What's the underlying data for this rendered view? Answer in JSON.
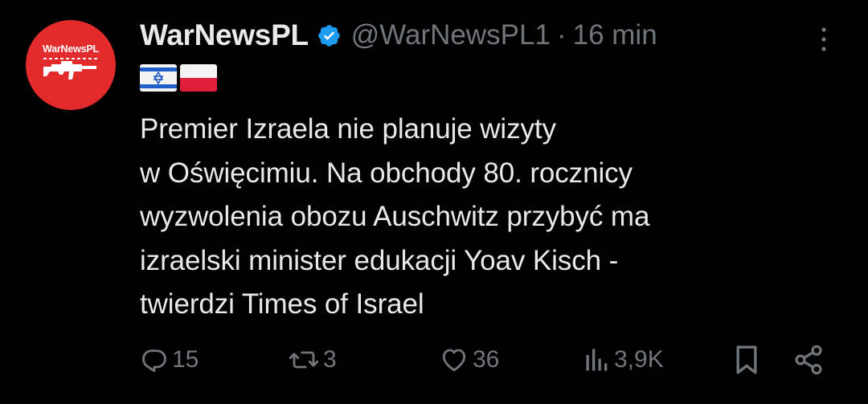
{
  "author": {
    "display_name": "WarNewsPL",
    "handle": "@WarNewsPL1",
    "separator": "·",
    "time": "16 min",
    "avatar_brand": "WarNewsPL"
  },
  "flags": [
    "israel-flag",
    "poland-flag"
  ],
  "tweet": {
    "text": "Premier Izraela nie planuje wizyty\nw Oświęcimiu. Na obchody 80. rocznicy\nwyzwolenia obozu Auschwitz przybyć ma\nizraelski minister edukacji Yoav Kisch -\ntwierdzi Times of Israel"
  },
  "actions": {
    "replies": "15",
    "reposts": "3",
    "likes": "36",
    "views": "3,9K"
  },
  "icons": {
    "verified": "verified-badge-icon",
    "more": "more-vertical-icon",
    "reply": "reply-icon",
    "repost": "repost-icon",
    "like": "heart-icon",
    "views": "views-chart-icon",
    "bookmark": "bookmark-icon",
    "share": "share-icon"
  },
  "colors": {
    "background": "#000000",
    "text_primary": "#e7e9ea",
    "text_secondary": "#71767b",
    "verified_blue": "#1d9bf0",
    "avatar_red": "#e32b2b"
  }
}
